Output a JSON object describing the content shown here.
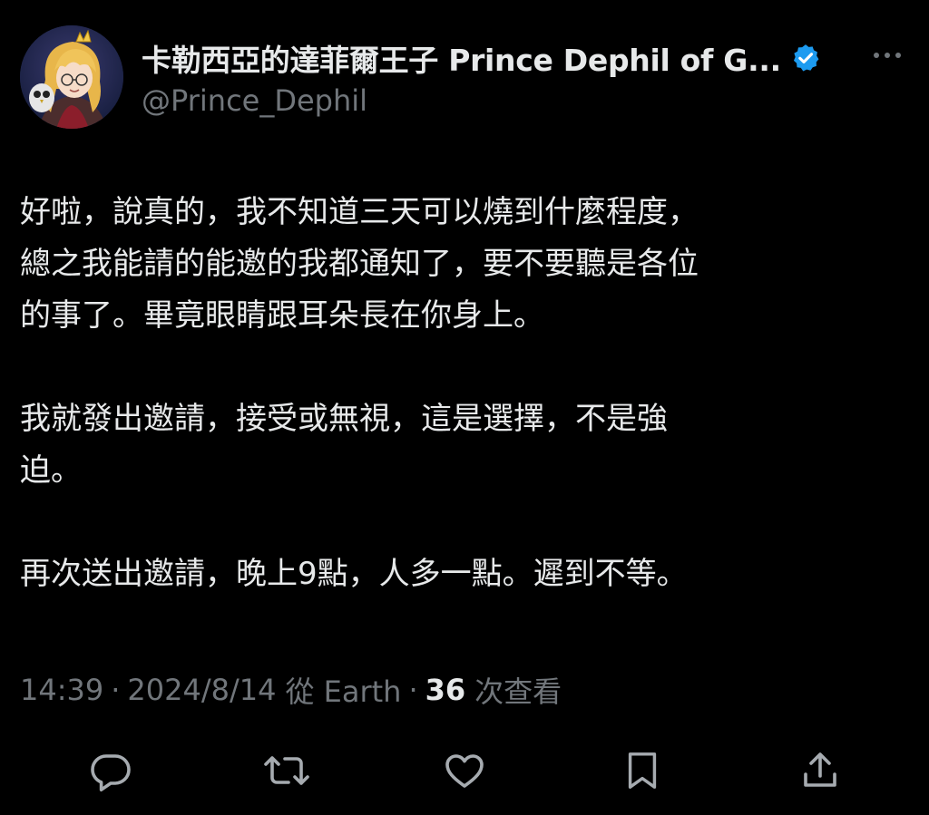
{
  "author": {
    "display_name": "卡勒西亞的達菲爾王子 Prince Dephil of G...",
    "handle": "@Prince_Dephil",
    "verified": true,
    "avatar_icon": "anime-avatar-icon"
  },
  "tweet": {
    "paragraphs": [
      "好啦，說真的，我不知道三天可以燒到什麼程度，\n總之我能請的能邀的我都通知了，要不要聽是各位\n的事了。畢竟眼睛跟耳朵長在你身上。",
      "我就發出邀請，接受或無視，這是選擇，不是強\n迫。",
      "再次送出邀請，晚上9點，人多一點。遲到不等。"
    ]
  },
  "meta": {
    "time": "14:39",
    "date": "2024/8/14",
    "location": "從 Earth",
    "views_count": "36",
    "views_label": "次查看"
  },
  "actions": {
    "reply_icon": "reply-icon",
    "retweet_icon": "retweet-icon",
    "like_icon": "heart-icon",
    "bookmark_icon": "bookmark-icon",
    "share_icon": "share-icon"
  },
  "colors": {
    "background": "#000000",
    "text": "#e7e9ea",
    "secondary": "#71767b",
    "verified": "#1d9bf0"
  }
}
